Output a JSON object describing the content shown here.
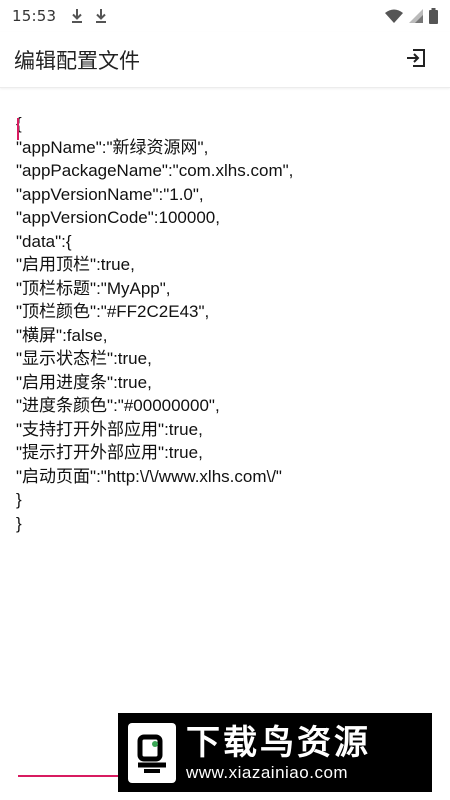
{
  "status_bar": {
    "time": "15:53",
    "icons": [
      "download-icon",
      "download-icon",
      "wifi-icon",
      "signal-icon",
      "battery-icon"
    ]
  },
  "app_bar": {
    "title": "编辑配置文件",
    "action_icon": "exit-to-app-icon"
  },
  "editor": {
    "lines": [
      "{",
      "\"appName\":\"新绿资源网\",",
      "\"appPackageName\":\"com.xlhs.com\",",
      "\"appVersionName\":\"1.0\",",
      "\"appVersionCode\":100000,",
      "\"data\":{",
      "\"启用顶栏\":true,",
      "\"顶栏标题\":\"MyApp\",",
      "\"顶栏颜色\":\"#FF2C2E43\",",
      "\"横屏\":false,",
      "\"显示状态栏\":true,",
      "\"启用进度条\":true,",
      "\"进度条颜色\":\"#00000000\",",
      "\"支持打开外部应用\":true,",
      "\"提示打开外部应用\":true,",
      "\"启动页面\":\"http:\\/\\/www.xlhs.com\\/\"",
      "}",
      "}"
    ]
  },
  "watermark": {
    "title": "下载鸟资源",
    "url": "www.xiazainiao.com"
  },
  "colors": {
    "accent": "#d81b60",
    "text": "#111111",
    "watermark_bg": "#000000"
  }
}
